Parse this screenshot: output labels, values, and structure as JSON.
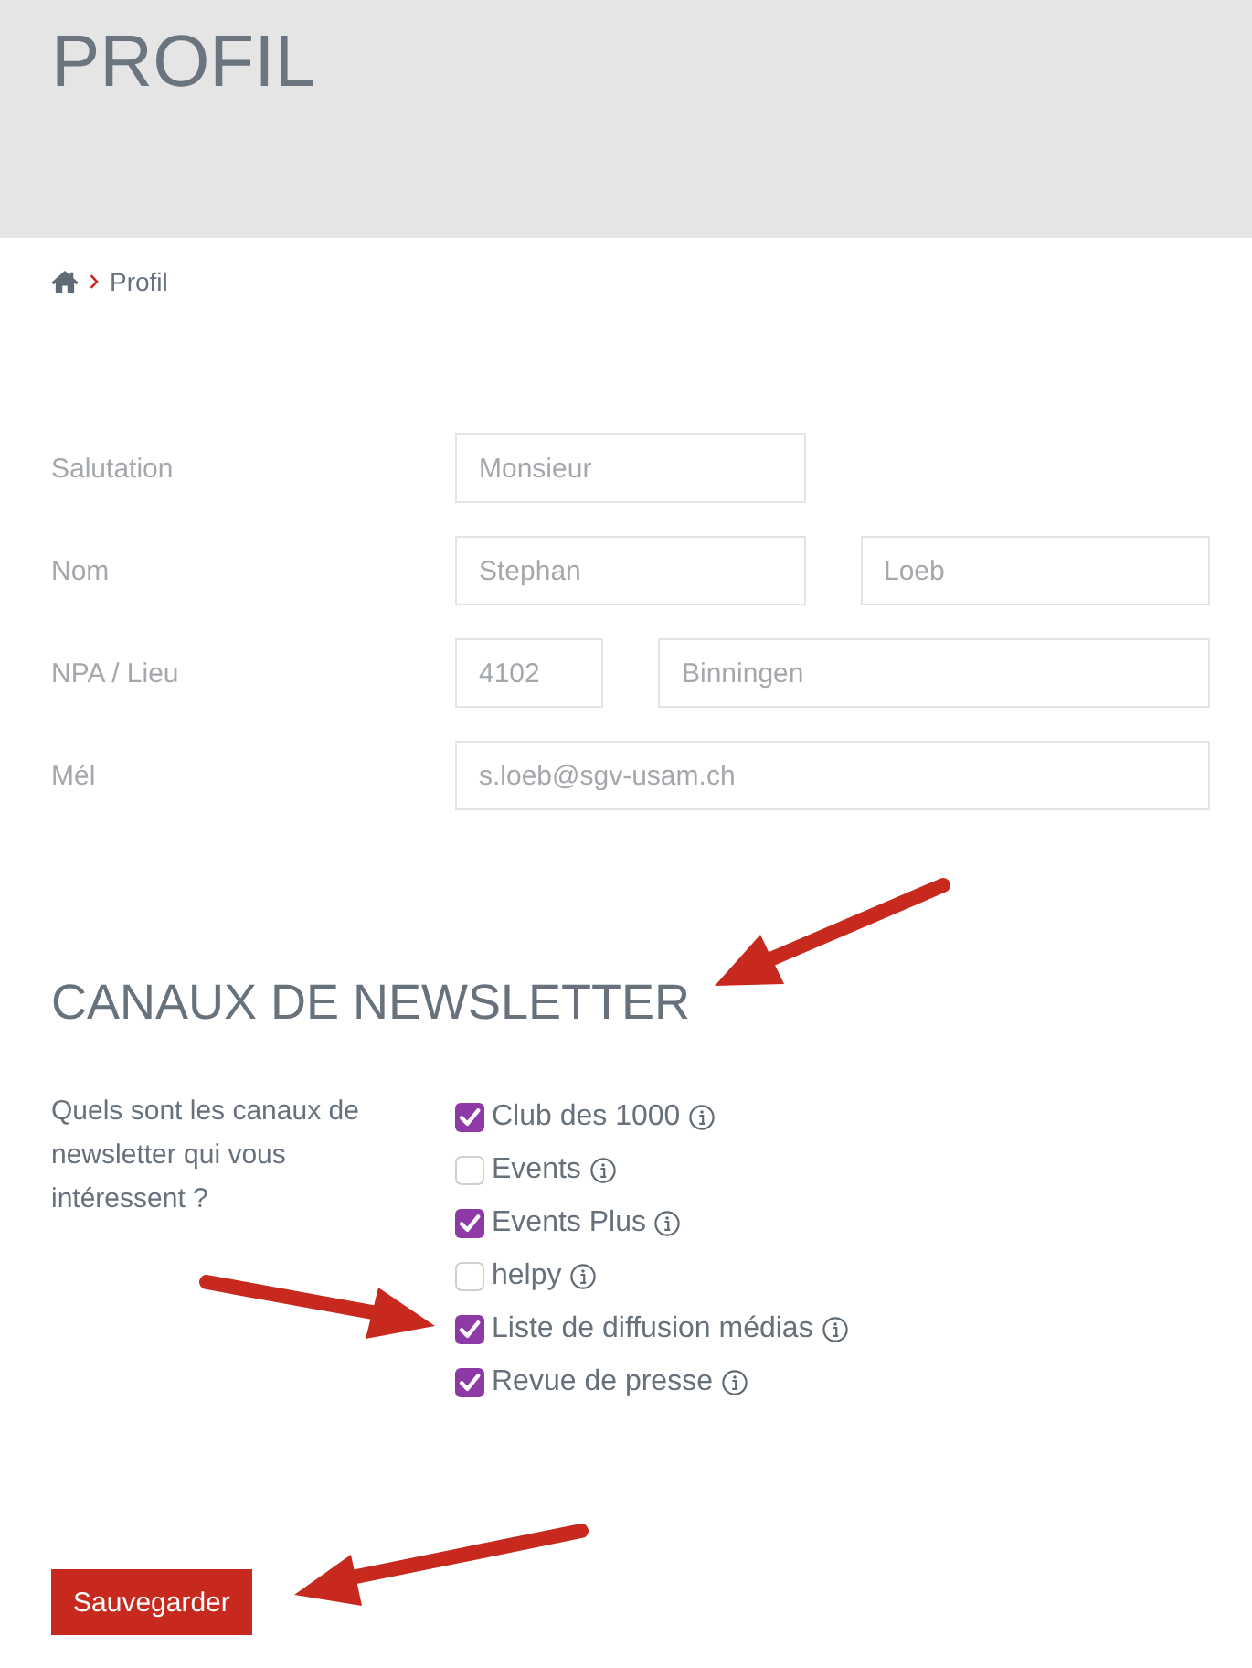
{
  "header": {
    "title": "PROFIL"
  },
  "breadcrumb": {
    "current": "Profil"
  },
  "form": {
    "rows": [
      {
        "label": "Salutation",
        "kind": "short",
        "disabled": true,
        "fields": [
          "Monsieur"
        ]
      },
      {
        "label": "Nom",
        "kind": "pair",
        "disabled": true,
        "fields": [
          "Stephan",
          "Loeb"
        ]
      },
      {
        "label": "NPA / Lieu",
        "kind": "zip_city",
        "disabled": true,
        "fields": [
          "4102",
          "Binningen"
        ]
      },
      {
        "label": "Mél",
        "kind": "full",
        "disabled": true,
        "fields": [
          "s.loeb@sgv-usam.ch"
        ]
      }
    ]
  },
  "newsletter": {
    "title": "CANAUX DE NEWSLETTER",
    "question": "Quels sont les canaux de newsletter qui vous intéressent ?",
    "options": [
      {
        "label": "Club des 1000",
        "checked": true
      },
      {
        "label": "Events",
        "checked": false
      },
      {
        "label": "Events Plus",
        "checked": true
      },
      {
        "label": "helpy",
        "checked": false
      },
      {
        "label": "Liste de diffusion médias",
        "checked": true
      },
      {
        "label": "Revue de presse",
        "checked": true
      }
    ]
  },
  "save_button": {
    "label": "Sauvegarder"
  }
}
